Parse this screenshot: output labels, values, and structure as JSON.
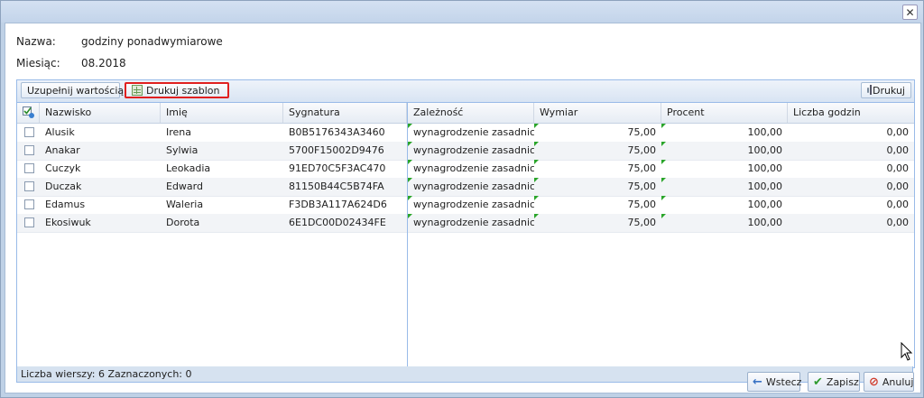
{
  "form": {
    "name_label": "Nazwa:",
    "name_value": "godziny ponadwymiarowe",
    "month_label": "Miesiąc:",
    "month_value": "08.2018"
  },
  "toolbar": {
    "fill_values_label": "Uzupełnij wartością",
    "print_template_label": "Drukuj szablon",
    "print_label": "Drukuj"
  },
  "columns": [
    "Nazwisko",
    "Imię",
    "Sygnatura",
    "Zależność",
    "Wymiar",
    "Procent",
    "Liczba godzin"
  ],
  "rows": [
    {
      "nazwisko": "Alusik",
      "imie": "Irena",
      "sygnatura": "B0B5176343A3460",
      "zaleznosc": "wynagrodzenie zasadnicze",
      "wymiar": "75,00",
      "procent": "100,00",
      "godziny": "0,00"
    },
    {
      "nazwisko": "Anakar",
      "imie": "Sylwia",
      "sygnatura": "5700F15002D9476",
      "zaleznosc": "wynagrodzenie zasadnicze",
      "wymiar": "75,00",
      "procent": "100,00",
      "godziny": "0,00"
    },
    {
      "nazwisko": "Cuczyk",
      "imie": "Leokadia",
      "sygnatura": "91ED70C5F3AC470",
      "zaleznosc": "wynagrodzenie zasadnicze",
      "wymiar": "75,00",
      "procent": "100,00",
      "godziny": "0,00"
    },
    {
      "nazwisko": "Duczak",
      "imie": "Edward",
      "sygnatura": "81150B44C5B74FA",
      "zaleznosc": "wynagrodzenie zasadnicze",
      "wymiar": "75,00",
      "procent": "100,00",
      "godziny": "0,00"
    },
    {
      "nazwisko": "Edamus",
      "imie": "Waleria",
      "sygnatura": "F3DB3A117A624D6",
      "zaleznosc": "wynagrodzenie zasadnicze",
      "wymiar": "75,00",
      "procent": "100,00",
      "godziny": "0,00"
    },
    {
      "nazwisko": "Ekosiwuk",
      "imie": "Dorota",
      "sygnatura": "6E1DC00D02434FE",
      "zaleznosc": "wynagrodzenie zasadnicze",
      "wymiar": "75,00",
      "procent": "100,00",
      "godziny": "0,00"
    }
  ],
  "status": "Liczba wierszy: 6 Zaznaczonych: 0",
  "footer": {
    "back_label": "Wstecz",
    "save_label": "Zapisz",
    "cancel_label": "Anuluj"
  },
  "icons": [
    "close-icon",
    "grid-icon",
    "print-icon",
    "check-all-icon",
    "arrow-left-icon",
    "checkmark-icon",
    "cancel-icon"
  ],
  "colors": {
    "highlight": "#e02020",
    "dirty_marker": "#2aa52a",
    "accent": "#99bbe8"
  }
}
